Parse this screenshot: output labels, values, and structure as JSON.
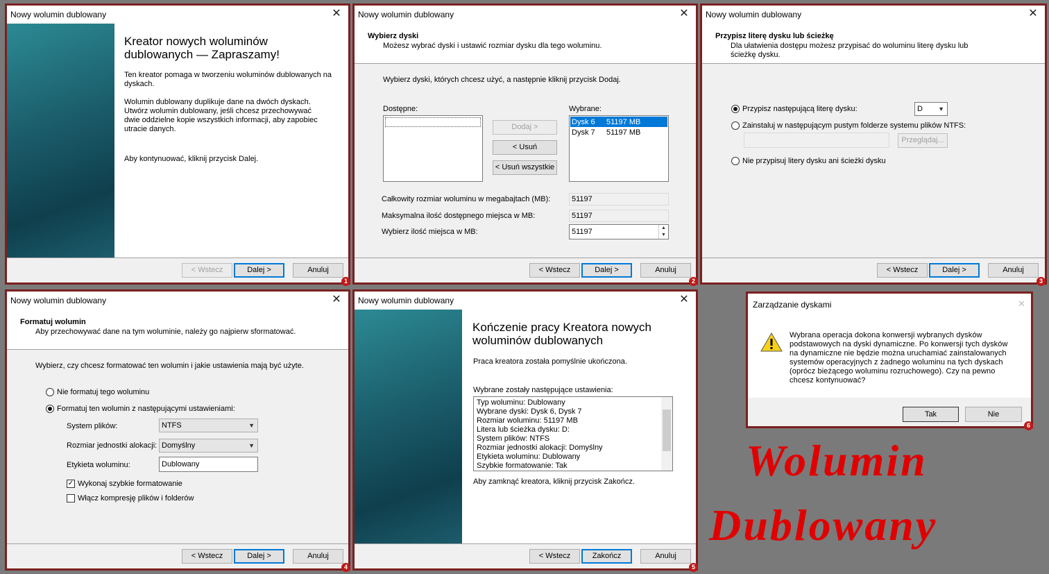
{
  "window_title": "Nowy wolumin dublowany",
  "close_glyph": "✕",
  "badges": [
    "1",
    "2",
    "3",
    "4",
    "5",
    "6"
  ],
  "p1": {
    "heading": "Kreator nowych woluminów dublowanych — Zapraszamy!",
    "para1": "Ten kreator pomaga w tworzeniu woluminów dublowanych na dyskach.",
    "para2": "Wolumin dublowany duplikuje dane na dwóch dyskach. Utwórz wolumin dublowany, jeśli chcesz przechowywać dwie oddzielne kopie wszystkich informacji, aby zapobiec utracie danych.",
    "para3": "Aby kontynuować, kliknij przycisk Dalej.",
    "back": "< Wstecz",
    "next": "Dalej >",
    "cancel": "Anuluj"
  },
  "p2": {
    "title": "Wybierz dyski",
    "subtitle": "Możesz wybrać dyski i ustawić rozmiar dysku dla tego woluminu.",
    "instruction": "Wybierz dyski, których chcesz użyć, a następnie kliknij przycisk Dodaj.",
    "available_label": "Dostępne:",
    "selected_label": "Wybrane:",
    "add": "Dodaj >",
    "remove": "< Usuń",
    "remove_all": "< Usuń wszystkie",
    "selected": [
      {
        "disk": "Dysk 6",
        "size": "51197 MB"
      },
      {
        "disk": "Dysk 7",
        "size": "51197 MB"
      }
    ],
    "total_label": "Całkowity rozmiar woluminu w megabajtach (MB):",
    "total_value": "51197",
    "max_label": "Maksymalna ilość dostępnego miejsca w MB:",
    "max_value": "51197",
    "choose_label": "Wybierz ilość miejsca w MB:",
    "choose_value": "51197",
    "back": "< Wstecz",
    "next": "Dalej >",
    "cancel": "Anuluj"
  },
  "p3": {
    "title": "Przypisz literę dysku lub ścieżkę",
    "subtitle": "Dla ułatwienia dostępu możesz przypisać do woluminu literę dysku lub ścieżkę dysku.",
    "opt1": "Przypisz następującą literę dysku:",
    "letter": "D",
    "opt2": "Zainstaluj w następującym pustym folderze systemu plików NTFS:",
    "browse": "Przeglądaj...",
    "opt3": "Nie przypisuj litery dysku ani ścieżki dysku",
    "back": "< Wstecz",
    "next": "Dalej >",
    "cancel": "Anuluj"
  },
  "p4": {
    "title": "Formatuj wolumin",
    "subtitle": "Aby przechowywać dane na tym woluminie, należy go najpierw sformatować.",
    "instruction": "Wybierz, czy chcesz formatować ten wolumin i jakie ustawienia mają być użyte.",
    "opt_no": "Nie formatuj tego woluminu",
    "opt_yes": "Formatuj ten wolumin z następującymi ustawieniami:",
    "fs_label": "System plików:",
    "fs_value": "NTFS",
    "alloc_label": "Rozmiar jednostki alokacji:",
    "alloc_value": "Domyślny",
    "vol_label": "Etykieta woluminu:",
    "vol_value": "Dublowany",
    "quick": "Wykonaj szybkie formatowanie",
    "compress": "Włącz kompresję plików i folderów",
    "check_glyph": "✓",
    "back": "< Wstecz",
    "next": "Dalej >",
    "cancel": "Anuluj"
  },
  "p5": {
    "heading": "Kończenie pracy Kreatora nowych woluminów dublowanych",
    "success": "Praca kreatora została pomyślnie ukończona.",
    "settings_label": "Wybrane zostały następujące ustawienia:",
    "settings": [
      "Typ woluminu: Dublowany",
      "Wybrane dyski: Dysk 6, Dysk 7",
      "Rozmiar woluminu: 51197 MB",
      "Litera lub ścieżka dysku: D:",
      "System plików: NTFS",
      "Rozmiar jednostki alokacji: Domyślny",
      "Etykieta woluminu: Dublowany",
      "Szybkie formatowanie: Tak"
    ],
    "close_hint": "Aby zamknąć kreatora, kliknij przycisk Zakończ.",
    "back": "< Wstecz",
    "finish": "Zakończ",
    "cancel": "Anuluj"
  },
  "p6": {
    "title": "Zarządzanie dyskami",
    "message": "Wybrana operacja dokona konwersji wybranych dysków podstawowych na dyski dynamiczne. Po konwersji tych dysków na dynamiczne nie będzie można uruchamiać zainstalowanych systemów operacyjnych z żadnego woluminu na tych dyskach (oprócz bieżącego woluminu rozruchowego). Czy na pewno chcesz kontynuować?",
    "yes": "Tak",
    "no": "Nie"
  },
  "banner": {
    "line1": "Wolumin",
    "line2": "Dublowany"
  }
}
